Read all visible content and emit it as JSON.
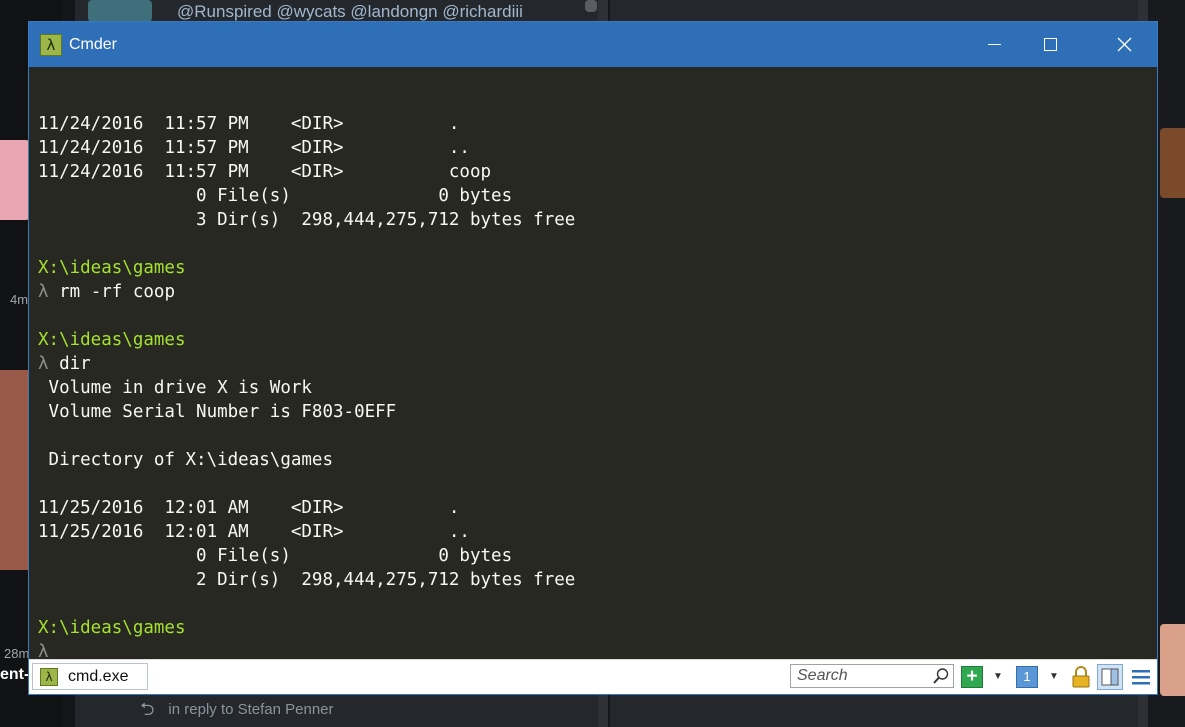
{
  "background": {
    "top_tweet_text": "@Runspired @wycats @landongn @richardiii",
    "left_time_1": "4m",
    "left_time_2": "28m",
    "left_bold_text": "ent-",
    "reply_text": "in reply to Stefan Penner"
  },
  "window": {
    "title": "Cmder",
    "app_icon": "λ"
  },
  "console": {
    "lines": [
      "",
      "11/24/2016  11:57 PM    <DIR>          .",
      "11/24/2016  11:57 PM    <DIR>          ..",
      "11/24/2016  11:57 PM    <DIR>          coop",
      "               0 File(s)              0 bytes",
      "               3 Dir(s)  298,444,275,712 bytes free",
      "",
      "X:\\ideas\\games",
      "λ rm -rf coop",
      "",
      "X:\\ideas\\games",
      "λ dir",
      " Volume in drive X is Work",
      " Volume Serial Number is F803-0EFF",
      "",
      " Directory of X:\\ideas\\games",
      "",
      "11/25/2016  12:01 AM    <DIR>          .",
      "11/25/2016  12:01 AM    <DIR>          ..",
      "               0 File(s)              0 bytes",
      "               2 Dir(s)  298,444,275,712 bytes free",
      "",
      "X:\\ideas\\games",
      "λ"
    ],
    "line_kinds": [
      "blank",
      "out",
      "out",
      "out",
      "out",
      "out",
      "blank",
      "prompt",
      "cmd",
      "blank",
      "prompt",
      "cmd",
      "out",
      "out",
      "blank",
      "out",
      "blank",
      "out",
      "out",
      "out",
      "out",
      "blank",
      "prompt",
      "cmd"
    ]
  },
  "statusbar": {
    "tab_label": "cmd.exe",
    "tab_icon": "λ",
    "search_placeholder": "Search",
    "new_tab_icon": "+",
    "tab_list_icon": "1"
  },
  "colors": {
    "titlebar": "#2f6fb7",
    "console_bg": "#272822",
    "console_fg": "#f8f8f2",
    "prompt_path": "#a6e22e"
  }
}
